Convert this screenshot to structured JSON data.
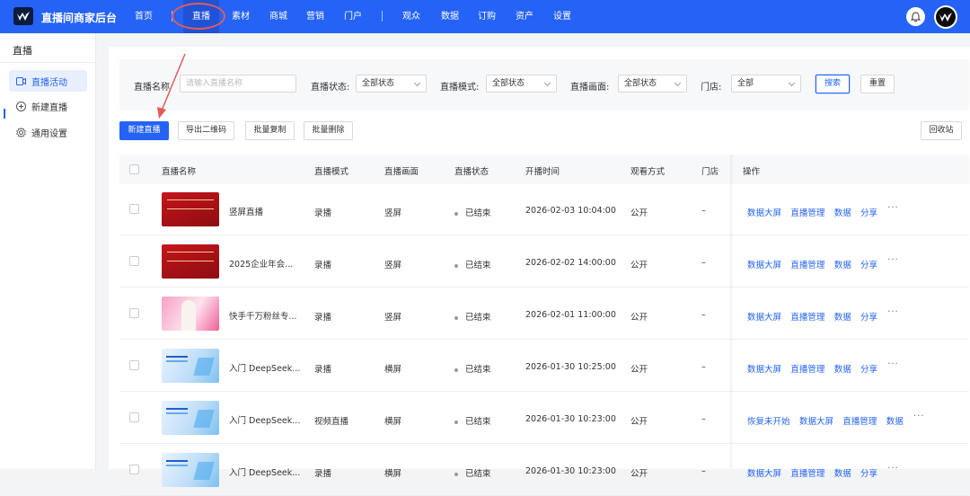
{
  "app": {
    "title": "直播间商家后台",
    "accent": "#2463f5"
  },
  "topnav": [
    {
      "label": "首页"
    },
    {
      "label": "直播",
      "active": true
    },
    {
      "label": "素材"
    },
    {
      "label": "商城"
    },
    {
      "label": "营销"
    },
    {
      "label": "门户"
    },
    {
      "label": "观众"
    },
    {
      "label": "数据"
    },
    {
      "label": "订购"
    },
    {
      "label": "资产"
    },
    {
      "label": "设置"
    }
  ],
  "sidebar": {
    "title": "直播",
    "items": [
      {
        "label": "直播活动",
        "icon": "video-icon",
        "active": true
      },
      {
        "label": "新建直播",
        "icon": "plus-circle-icon"
      },
      {
        "label": "通用设置",
        "icon": "gear-icon"
      }
    ]
  },
  "filters": {
    "name_label": "直播名称",
    "name_placeholder": "请输入直播名称",
    "status_label": "直播状态:",
    "status_value": "全部状态",
    "mode_label": "直播模式:",
    "mode_value": "全部状态",
    "screen_label": "直播画面:",
    "screen_value": "全部状态",
    "store_label": "门店:",
    "store_value": "全部",
    "search_label": "搜索",
    "reset_label": "重置"
  },
  "actions": {
    "new_live": "新建直播",
    "export_qr": "导出二维码",
    "batch_copy": "批量复制",
    "batch_delete": "批量删除",
    "recycle_bin": "回收站"
  },
  "table": {
    "headers": {
      "name": "直播名称",
      "mode": "直播模式",
      "screen": "直播画面",
      "status": "直播状态",
      "start_time": "开播时间",
      "view_mode": "观看方式",
      "store": "门店",
      "ops": "操作"
    },
    "rows": [
      {
        "thumb": "red",
        "name": "竖屏直播",
        "mode": "录播",
        "screen": "竖屏",
        "status": "已结束",
        "start_time": "2026-02-03 10:04:00",
        "view_mode": "公开",
        "store": "–",
        "ops": [
          "数据大屏",
          "直播管理",
          "数据",
          "分享"
        ],
        "more": "···"
      },
      {
        "thumb": "red",
        "name": "2025企业年会...",
        "mode": "录播",
        "screen": "竖屏",
        "status": "已结束",
        "start_time": "2026-02-02 14:00:00",
        "view_mode": "公开",
        "store": "–",
        "ops": [
          "数据大屏",
          "直播管理",
          "数据",
          "分享"
        ],
        "more": "···"
      },
      {
        "thumb": "pink",
        "name": "快手千万粉丝专...",
        "mode": "录播",
        "screen": "竖屏",
        "status": "已结束",
        "start_time": "2026-02-01 11:00:00",
        "view_mode": "公开",
        "store": "–",
        "ops": [
          "数据大屏",
          "直播管理",
          "数据",
          "分享"
        ],
        "more": "···"
      },
      {
        "thumb": "blue",
        "name": "入门 DeepSeek...",
        "mode": "录播",
        "screen": "横屏",
        "status": "已结束",
        "start_time": "2026-01-30 10:25:00",
        "view_mode": "公开",
        "store": "–",
        "ops": [
          "数据大屏",
          "直播管理",
          "数据",
          "分享"
        ],
        "more": "···"
      },
      {
        "thumb": "blue",
        "name": "入门 DeepSeek...",
        "mode": "视频直播",
        "screen": "横屏",
        "status": "已结束",
        "start_time": "2026-01-30 10:23:00",
        "view_mode": "公开",
        "store": "–",
        "ops": [
          "恢复未开始",
          "数据大屏",
          "直播管理",
          "数据"
        ],
        "more": "···"
      },
      {
        "thumb": "blue",
        "name": "入门 DeepSeek...",
        "mode": "录播",
        "screen": "横屏",
        "status": "已结束",
        "start_time": "2026-01-30 10:23:00",
        "view_mode": "公开",
        "store": "–",
        "ops": [
          "数据大屏",
          "直播管理",
          "数据",
          "分享"
        ],
        "more": "···"
      }
    ]
  }
}
